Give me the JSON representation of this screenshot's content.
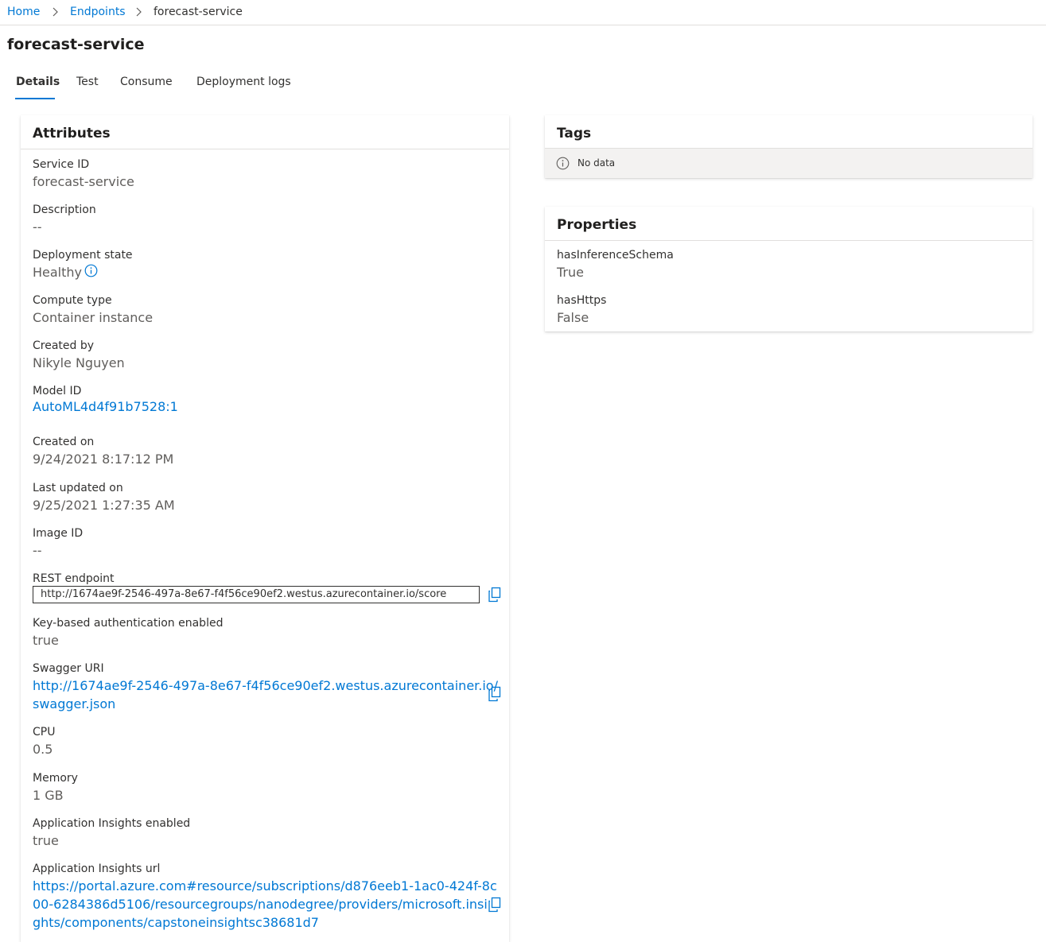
{
  "breadcrumb": {
    "home": "Home",
    "endpoints": "Endpoints",
    "current": "forecast-service"
  },
  "page": {
    "title": "forecast-service"
  },
  "tabs": [
    {
      "label": "Details",
      "active": true
    },
    {
      "label": "Test",
      "active": false
    },
    {
      "label": "Consume",
      "active": false
    },
    {
      "label": "Deployment logs",
      "active": false
    }
  ],
  "attributes": {
    "title": "Attributes",
    "service_id": {
      "label": "Service ID",
      "value": "forecast-service"
    },
    "description": {
      "label": "Description",
      "value": "--"
    },
    "deployment_state": {
      "label": "Deployment state",
      "value": "Healthy"
    },
    "compute_type": {
      "label": "Compute type",
      "value": "Container instance"
    },
    "created_by": {
      "label": "Created by",
      "value": "Nikyle Nguyen"
    },
    "model_id": {
      "label": "Model ID",
      "value": "AutoML4d4f91b7528:1"
    },
    "created_on": {
      "label": "Created on",
      "value": "9/24/2021 8:17:12 PM"
    },
    "last_updated_on": {
      "label": "Last updated on",
      "value": "9/25/2021 1:27:35 AM"
    },
    "image_id": {
      "label": "Image ID",
      "value": "--"
    },
    "rest_endpoint": {
      "label": "REST endpoint",
      "value": "http://1674ae9f-2546-497a-8e67-f4f56ce90ef2.westus.azurecontainer.io/score"
    },
    "key_auth": {
      "label": "Key-based authentication enabled",
      "value": "true"
    },
    "swagger_uri": {
      "label": "Swagger URI",
      "line1": "http://1674ae9f-2546-497a-8e67-f4f56ce90ef2.westus.azurecontainer.io/",
      "line2": "swagger.json"
    },
    "cpu": {
      "label": "CPU",
      "value": "0.5"
    },
    "memory": {
      "label": "Memory",
      "value": "1 GB"
    },
    "app_insights_enabled": {
      "label": "Application Insights enabled",
      "value": "true"
    },
    "app_insights_url": {
      "label": "Application Insights url",
      "line1": "https://portal.azure.com#resource/subscriptions/d876eeb1-1ac0-424f-8c",
      "line2": "00-6284386d5106/resourcegroups/nanodegree/providers/microsoft.insi",
      "line3": "ghts/components/capstoneinsightsc38681d7"
    }
  },
  "tags": {
    "title": "Tags",
    "empty_text": "No data"
  },
  "properties": {
    "title": "Properties",
    "items": [
      {
        "label": "hasInferenceSchema",
        "value": "True"
      },
      {
        "label": "hasHttps",
        "value": "False"
      }
    ]
  },
  "icons": {
    "chevron": "chevron-right-icon",
    "info": "info-icon",
    "copy": "copy-icon"
  },
  "colors": {
    "accent": "#0078d4",
    "text": "#323130",
    "secondary_text": "#605e5c",
    "no_data_bg": "#f3f2f1"
  }
}
